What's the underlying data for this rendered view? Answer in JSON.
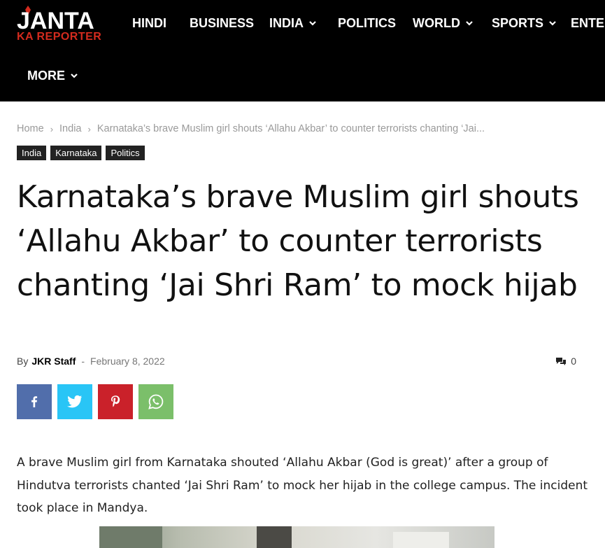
{
  "header": {
    "logo": {
      "main": "JANTA",
      "sub": "KA REPORTER"
    },
    "nav": [
      {
        "label": "HINDI",
        "dropdown": false
      },
      {
        "label": "BUSINESS",
        "dropdown": false
      },
      {
        "label": "INDIA",
        "dropdown": true
      },
      {
        "label": "POLITICS",
        "dropdown": false
      },
      {
        "label": "WORLD",
        "dropdown": true
      },
      {
        "label": "SPORTS",
        "dropdown": true
      },
      {
        "label": "ENTE",
        "dropdown": false
      },
      {
        "label": "MORE",
        "dropdown": true
      }
    ]
  },
  "breadcrumb": {
    "items": [
      "Home",
      "India",
      "Karnataka’s brave Muslim girl shouts ‘Allahu Akbar’ to counter terrorists chanting ‘Jai..."
    ],
    "separator": "›"
  },
  "tags": [
    "India",
    "Karnataka",
    "Politics"
  ],
  "article": {
    "title": "Karnataka’s brave Muslim girl shouts ‘Allahu Akbar’ to counter terrorists chanting ‘Jai Shri Ram’ to mock hijab",
    "by_label": "By",
    "author": "JKR Staff",
    "dash": "-",
    "date": "February 8, 2022",
    "comments_count": "0",
    "body": "A brave Muslim girl from Karnataka shouted ‘Allahu Akbar (God is great)’ after a group of Hindutva terrorists chanted ‘Jai Shri Ram’ to mock her hijab in the college campus. The incident took place in Mandya."
  },
  "share": [
    {
      "name": "facebook",
      "icon": "facebook-icon",
      "color": "#516eab"
    },
    {
      "name": "twitter",
      "icon": "twitter-icon",
      "color": "#29c5f6"
    },
    {
      "name": "pinterest",
      "icon": "pinterest-icon",
      "color": "#ca212a"
    },
    {
      "name": "whatsapp",
      "icon": "whatsapp-icon",
      "color": "#7bbf6a"
    }
  ],
  "colors": {
    "header_bg": "#000000",
    "logo_accent": "#d42b1e",
    "tag_bg": "#222222"
  }
}
